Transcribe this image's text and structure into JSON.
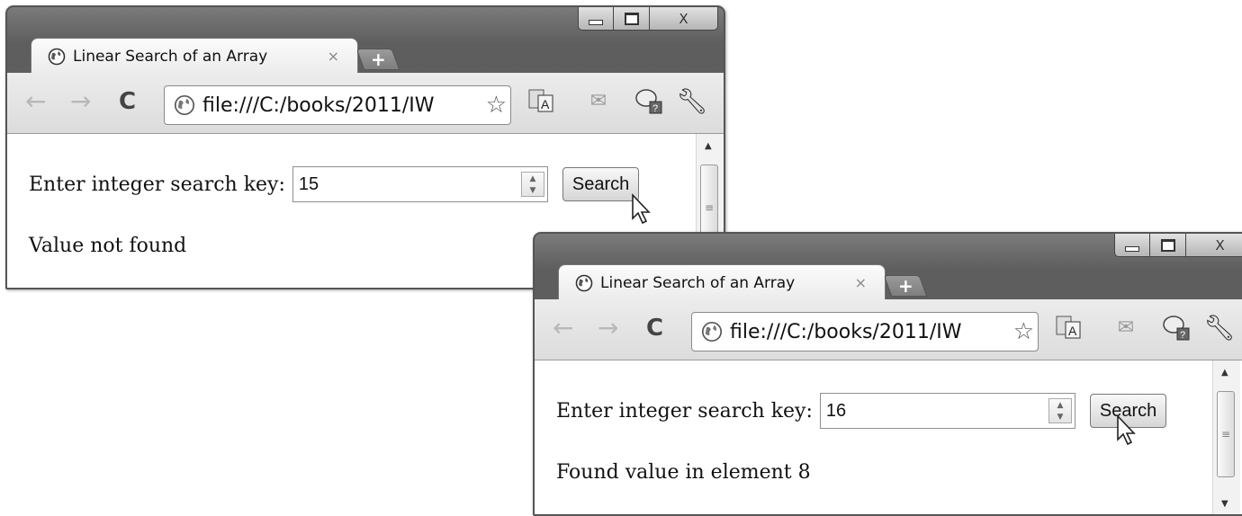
{
  "windows": [
    {
      "tab_title": "Linear Search of an Array",
      "tab_close": "×",
      "new_tab": "+",
      "url": "file:///C:/books/2011/IW",
      "controls": {
        "close": "X"
      },
      "nav": {
        "back": "←",
        "forward": "→",
        "reload": "C"
      },
      "prompt_label": "Enter integer search key:",
      "search_value": "15",
      "search_button": "Search",
      "result": "Value not found",
      "scroll": {
        "up": "▲",
        "grip": "≡",
        "down": "▼"
      }
    },
    {
      "tab_title": "Linear Search of an Array",
      "tab_close": "×",
      "new_tab": "+",
      "url": "file:///C:/books/2011/IW",
      "controls": {
        "close": "X"
      },
      "nav": {
        "back": "←",
        "forward": "→",
        "reload": "C"
      },
      "prompt_label": "Enter integer search key:",
      "search_value": "16",
      "search_button": "Search",
      "result": "Found value in element 8",
      "scroll": {
        "up": "▲",
        "grip": "≡",
        "down": "▼"
      }
    }
  ],
  "icons": {
    "favicon": "globe-icon",
    "bookmark": "star-icon",
    "translate": "translate-icon",
    "mail": "mail-icon",
    "help": "help-icon",
    "settings": "wrench-icon",
    "pointer": "mouse-cursor-icon"
  }
}
